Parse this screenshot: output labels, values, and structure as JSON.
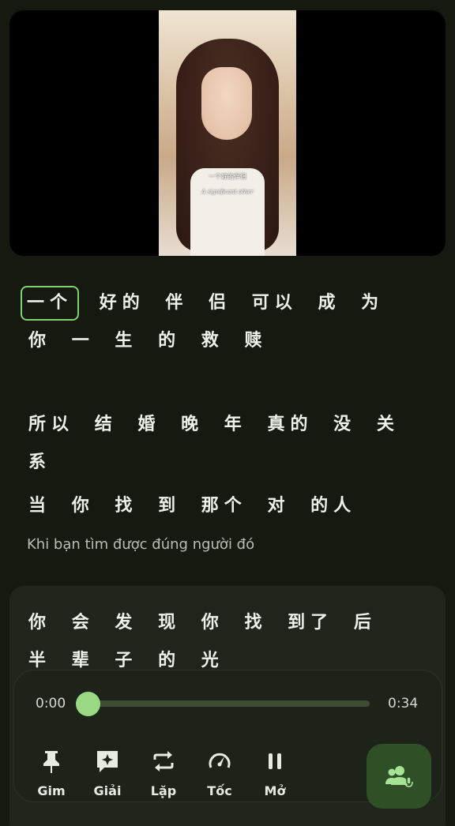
{
  "video": {
    "subtitle_zh": "一个好的伴侣",
    "subtitle_en": "A significant other"
  },
  "lyrics": [
    {
      "words": [
        "一个",
        "好的",
        "伴",
        "侣",
        "可以",
        "成",
        "为",
        "你",
        "一",
        "生",
        "的",
        "救",
        "赎"
      ]
    },
    {
      "words": [
        "所以",
        "结",
        "婚",
        "晚",
        "年",
        "真的",
        "没",
        "关",
        "系"
      ]
    },
    {
      "words": [
        "当",
        "你",
        "找",
        "到",
        "那个",
        "对",
        "的人"
      ],
      "translation": "Khi bạn tìm được đúng người đó"
    },
    {
      "words": [
        "你",
        "会",
        "发",
        "现",
        "你",
        "找",
        "到了",
        "后",
        "半",
        "辈",
        "子",
        "的",
        "光"
      ]
    }
  ],
  "player": {
    "current_time": "0:00",
    "total_time": "0:34",
    "progress": 0.0,
    "controls": [
      {
        "label": "Gim",
        "icon": "pin-icon"
      },
      {
        "label": "Giải",
        "icon": "explain-icon"
      },
      {
        "label": "Lặp",
        "icon": "repeat-icon"
      },
      {
        "label": "Tốc",
        "icon": "speed-icon"
      },
      {
        "label": "Mở",
        "icon": "pause-icon"
      }
    ],
    "voice_button_icon": "voice-users-icon"
  },
  "colors": {
    "accent": "#9ad984",
    "background": "#151910",
    "active_border": "#7fcf73"
  }
}
